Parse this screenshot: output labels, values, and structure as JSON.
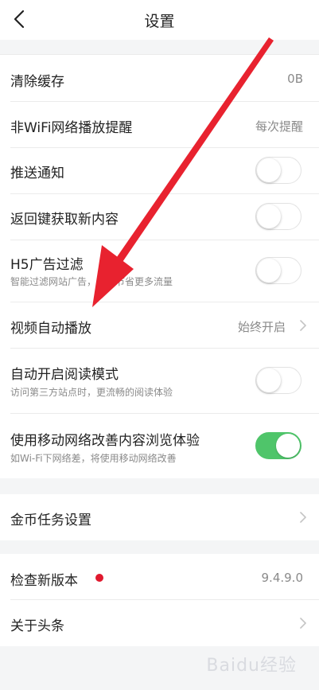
{
  "header": {
    "title": "设置"
  },
  "rows": {
    "clear_cache": {
      "label": "清除缓存",
      "value": "0B"
    },
    "non_wifi": {
      "label": "非WiFi网络播放提醒",
      "value": "每次提醒"
    },
    "push": {
      "label": "推送通知",
      "on": false
    },
    "back_key": {
      "label": "返回键获取新内容",
      "on": false
    },
    "h5_filter": {
      "label": "H5广告过滤",
      "sub": "智能过滤网站广告，为你节省更多流量",
      "on": false
    },
    "video_autoplay": {
      "label": "视频自动播放",
      "value": "始终开启"
    },
    "reader_mode": {
      "label": "自动开启阅读模式",
      "sub": "访问第三方站点时，更流畅的阅读体验",
      "on": false
    },
    "mobile_network": {
      "label": "使用移动网络改善内容浏览体验",
      "sub": "如Wi-Fi下网络差，将使用移动网络改善",
      "on": true
    },
    "coin_task": {
      "label": "金币任务设置"
    },
    "check_update": {
      "label": "检查新版本",
      "value": "9.4.9.0"
    },
    "about": {
      "label": "关于头条"
    }
  },
  "watermark": {
    "text": "Baidu经验"
  },
  "colors": {
    "toggle_on": "#4fc56a",
    "red_dot": "#e0192e",
    "arrow": "#e8222f"
  },
  "icons": {
    "back": "chevron-left-icon",
    "row_more": "chevron-right-icon"
  }
}
